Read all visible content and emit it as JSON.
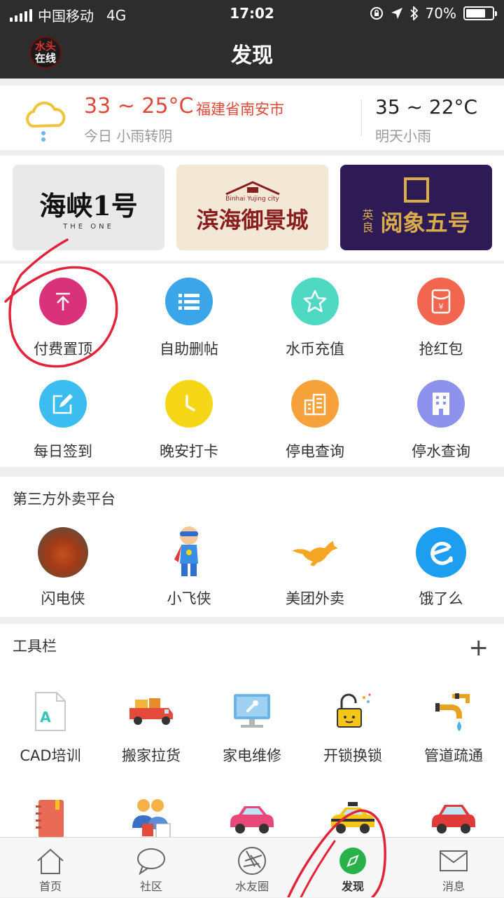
{
  "status": {
    "carrier": "中国移动",
    "network": "4G",
    "time": "17:02",
    "battery": "70%"
  },
  "header": {
    "title": "发现",
    "logo_line1": "水头",
    "logo_line2": "在线"
  },
  "weather": {
    "temp_range": "33 ~ 25°C",
    "city": "福建省南安市",
    "today": "今日 小雨转阴",
    "tomorrow_temp": "35 ~ 22°C",
    "tomorrow": "明天小雨"
  },
  "banners": [
    {
      "title": "海峡1号",
      "subtitle": "THE ONE"
    },
    {
      "title": "滨海御景城",
      "subtitle": "Binhai Yujing city"
    },
    {
      "title": "阅象五号",
      "subtitle": "英良"
    }
  ],
  "services": [
    {
      "label": "付费置顶",
      "icon": "arrow-up-icon",
      "color": "#d9317a"
    },
    {
      "label": "自助删帖",
      "icon": "list-icon",
      "color": "#3aa5e8"
    },
    {
      "label": "水币充值",
      "icon": "star-icon",
      "color": "#4fd9c2"
    },
    {
      "label": "抢红包",
      "icon": "red-packet-icon",
      "color": "#f2664f"
    },
    {
      "label": "每日签到",
      "icon": "edit-icon",
      "color": "#3bbdf0"
    },
    {
      "label": "晚安打卡",
      "icon": "clock-icon",
      "color": "#f5d717"
    },
    {
      "label": "停电查询",
      "icon": "building-icon",
      "color": "#f7a13a"
    },
    {
      "label": "停水查询",
      "icon": "office-icon",
      "color": "#8d93ec"
    }
  ],
  "food": {
    "title": "第三方外卖平台",
    "items": [
      {
        "label": "闪电侠",
        "icon": "food-photo-icon"
      },
      {
        "label": "小飞侠",
        "icon": "superhero-icon"
      },
      {
        "label": "美团外卖",
        "icon": "kangaroo-icon"
      },
      {
        "label": "饿了么",
        "icon": "eleme-icon"
      }
    ]
  },
  "tools": {
    "title": "工具栏",
    "plus": "+",
    "items": [
      {
        "label": "CAD培训",
        "icon": "document-a-icon"
      },
      {
        "label": "搬家拉货",
        "icon": "truck-icon"
      },
      {
        "label": "家电维修",
        "icon": "monitor-repair-icon"
      },
      {
        "label": "开锁换锁",
        "icon": "lock-icon"
      },
      {
        "label": "管道疏通",
        "icon": "pipe-icon"
      },
      {
        "label": "",
        "icon": "notebook-icon"
      },
      {
        "label": "",
        "icon": "people-icon"
      },
      {
        "label": "",
        "icon": "pink-car-icon"
      },
      {
        "label": "",
        "icon": "taxi-icon"
      },
      {
        "label": "",
        "icon": "red-car-icon"
      }
    ]
  },
  "tabs": [
    {
      "label": "首页",
      "icon": "home-icon"
    },
    {
      "label": "社区",
      "icon": "chat-icon"
    },
    {
      "label": "水友圈",
      "icon": "aperture-icon"
    },
    {
      "label": "发现",
      "icon": "compass-icon",
      "active": true
    },
    {
      "label": "消息",
      "icon": "mail-icon"
    }
  ]
}
